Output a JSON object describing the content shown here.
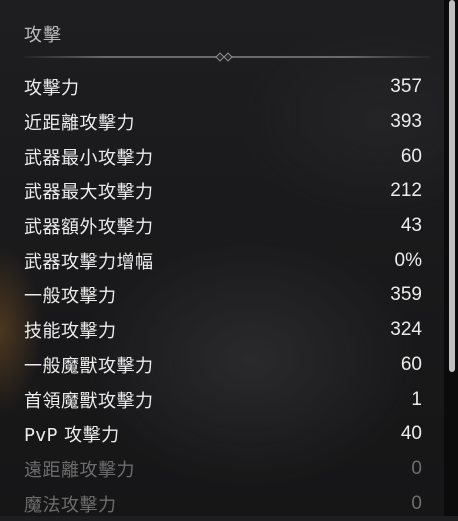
{
  "section": {
    "title": "攻擊"
  },
  "stats": [
    {
      "label": "攻擊力",
      "value": "357",
      "dim": false
    },
    {
      "label": "近距離攻擊力",
      "value": "393",
      "dim": false
    },
    {
      "label": "武器最小攻擊力",
      "value": "60",
      "dim": false
    },
    {
      "label": "武器最大攻擊力",
      "value": "212",
      "dim": false
    },
    {
      "label": "武器額外攻擊力",
      "value": "43",
      "dim": false
    },
    {
      "label": "武器攻擊力增幅",
      "value": "0%",
      "dim": false
    },
    {
      "label": "一般攻擊力",
      "value": "359",
      "dim": false
    },
    {
      "label": "技能攻擊力",
      "value": "324",
      "dim": false
    },
    {
      "label": "一般魔獸攻擊力",
      "value": "60",
      "dim": false
    },
    {
      "label": "首領魔獸攻擊力",
      "value": "1",
      "dim": false
    },
    {
      "label": "PvP 攻擊力",
      "value": "40",
      "dim": false
    },
    {
      "label": "遠距離攻擊力",
      "value": "0",
      "dim": true
    },
    {
      "label": "魔法攻擊力",
      "value": "0",
      "dim": true
    }
  ],
  "scrollbar": {
    "position": 0
  },
  "icons": {
    "divider_ornament": "diamond-ornament-icon"
  },
  "colors": {
    "text_primary": "#ececec",
    "text_dimmed": "#6d6d6d",
    "title": "#bdbdbd",
    "scroll_thumb": "#bfbfbf"
  }
}
